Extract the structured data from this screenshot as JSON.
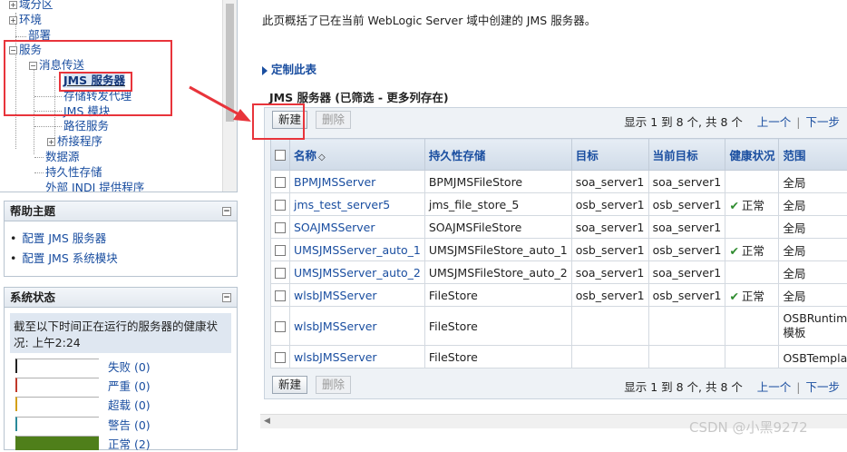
{
  "nav_tree": {
    "items": [
      {
        "label": "域分区",
        "toggle": "+"
      },
      {
        "label": "环境",
        "toggle": "+"
      },
      {
        "label": "部署",
        "toggle": ""
      },
      {
        "label": "服务",
        "toggle": "−"
      },
      {
        "label": "消息传送",
        "toggle": "−"
      },
      {
        "label": "JMS 服务器",
        "toggle": ""
      },
      {
        "label": "存储转发代理",
        "toggle": ""
      },
      {
        "label": "JMS 模块",
        "toggle": ""
      },
      {
        "label": "路径服务",
        "toggle": ""
      },
      {
        "label": "桥接程序",
        "toggle": "+"
      },
      {
        "label": "数据源",
        "toggle": ""
      },
      {
        "label": "持久性存储",
        "toggle": ""
      },
      {
        "label": "外部 JNDI 提供程序",
        "toggle": ""
      }
    ]
  },
  "help": {
    "title": "帮助主题",
    "links": [
      "配置 JMS 服务器",
      "配置 JMS 系统模块"
    ]
  },
  "system_status": {
    "title": "系统状态",
    "description": "截至以下时间正在运行的服务器的健康状况: 上午2:24",
    "rows": [
      {
        "label": "失败 (0)",
        "color": "#222222",
        "fill": 0
      },
      {
        "label": "严重 (0)",
        "color": "#c0392b",
        "fill": 0
      },
      {
        "label": "超载 (0)",
        "color": "#d4a017",
        "fill": 0
      },
      {
        "label": "警告 (0)",
        "color": "#2a8a9a",
        "fill": 0
      },
      {
        "label": "正常 (2)",
        "color": "#4f7f1a",
        "fill": 1
      }
    ]
  },
  "main": {
    "intro": "此页概括了已在当前 WebLogic Server 域中创建的 JMS 服务器。",
    "customize": "定制此表",
    "table_title": "JMS 服务器 (已筛选 - 更多列存在)",
    "buttons": {
      "new": "新建",
      "delete": "删除"
    },
    "pager": {
      "summary": "显示 1 到 8 个, 共 8 个",
      "prev": "上一个",
      "next": "下一步"
    },
    "columns": [
      "名称",
      "持久性存储",
      "目标",
      "当前目标",
      "健康状况",
      "范围"
    ],
    "rows": [
      {
        "name": "BPMJMSServer",
        "store": "BPMJMSFileStore",
        "target": "soa_server1",
        "current": "soa_server1",
        "health": "",
        "scope": "全局"
      },
      {
        "name": "jms_test_server5",
        "store": "jms_file_store_5",
        "target": "osb_server1",
        "current": "osb_server1",
        "health": "正常",
        "scope": "全局"
      },
      {
        "name": "SOAJMSServer",
        "store": "SOAJMSFileStore",
        "target": "soa_server1",
        "current": "soa_server1",
        "health": "",
        "scope": "全局"
      },
      {
        "name": "UMSJMSServer_auto_1",
        "store": "UMSJMSFileStore_auto_1",
        "target": "osb_server1",
        "current": "osb_server1",
        "health": "正常",
        "scope": "全局"
      },
      {
        "name": "UMSJMSServer_auto_2",
        "store": "UMSJMSFileStore_auto_2",
        "target": "soa_server1",
        "current": "soa_server1",
        "health": "",
        "scope": "全局"
      },
      {
        "name": "wlsbJMSServer",
        "store": "FileStore",
        "target": "osb_server1",
        "current": "osb_server1",
        "health": "正常",
        "scope": "全局"
      },
      {
        "name": "wlsbJMSServer",
        "store": "FileStore",
        "target": "",
        "current": "",
        "health": "",
        "scope": "OSBRuntimeResou 模板"
      },
      {
        "name": "wlsbJMSServer",
        "store": "FileStore",
        "target": "",
        "current": "",
        "health": "",
        "scope": "OSBTemplate模板"
      }
    ]
  },
  "watermark": "CSDN @小黑9272",
  "colors": {
    "annotation_red": "#e8343b",
    "link_blue": "#1a4ea0"
  }
}
